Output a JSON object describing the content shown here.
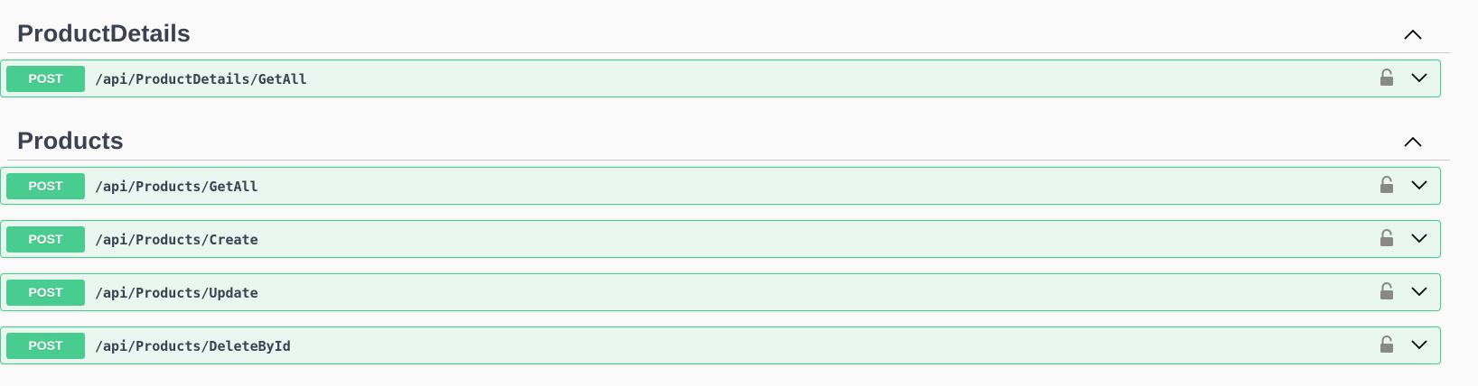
{
  "sections": [
    {
      "title": "ProductDetails",
      "operations": [
        {
          "method": "POST",
          "path": "/api/ProductDetails/GetAll"
        }
      ]
    },
    {
      "title": "Products",
      "operations": [
        {
          "method": "POST",
          "path": "/api/Products/GetAll"
        },
        {
          "method": "POST",
          "path": "/api/Products/Create"
        },
        {
          "method": "POST",
          "path": "/api/Products/Update"
        },
        {
          "method": "POST",
          "path": "/api/Products/DeleteById"
        }
      ]
    }
  ],
  "icons": {
    "collapse": "chevron-up-icon",
    "expand": "chevron-down-icon",
    "auth": "lock-icon"
  },
  "colors": {
    "post_accent": "#49cc90",
    "post_background": "#e8f6ef"
  }
}
